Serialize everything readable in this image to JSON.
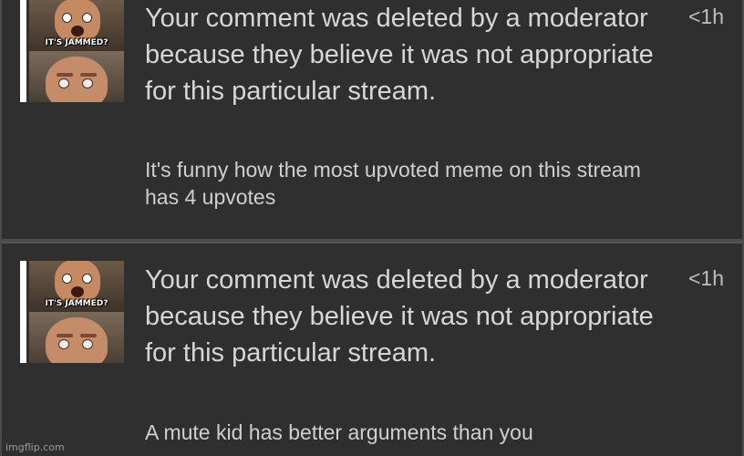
{
  "notifications": [
    {
      "title": "Your comment was deleted by a moderator because they believe it was not appropriate for this particular stream.",
      "comment": "It's funny how the most upvoted meme on this stream has 4 upvotes",
      "time": "<1h",
      "thumbnail_caption": "IT'S JAMMED?"
    },
    {
      "title": "Your comment was deleted by a moderator because they believe it was not appropriate for this particular stream.",
      "comment": "A mute kid has better arguments than you",
      "time": "<1h",
      "thumbnail_caption": "IT'S JAMMED?"
    }
  ],
  "watermark": "imgflip.com",
  "colors": {
    "background": "#2f2f2f",
    "text_primary": "#d6d6d6",
    "divider": "#4d4d4d"
  }
}
